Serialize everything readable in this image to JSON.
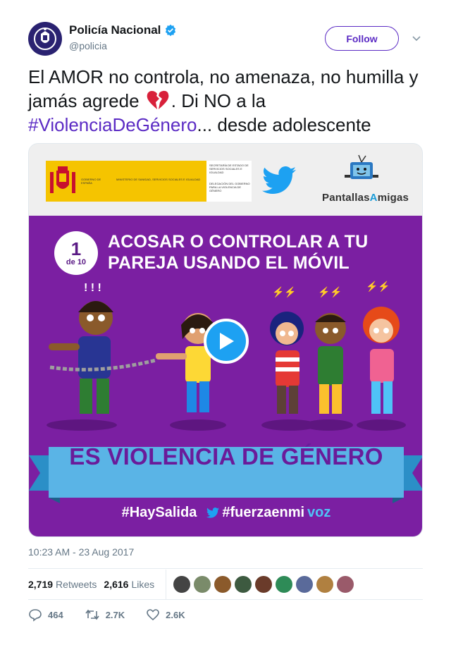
{
  "account": {
    "display_name": "Policía Nacional",
    "handle": "@policia",
    "verified": true,
    "follow_label": "Follow"
  },
  "tweet": {
    "text_part1": "El AMOR no controla, no amenaza, no humilla y jamás agrede ",
    "text_part2": ". Di NO a la ",
    "hashtag": "#ViolenciaDeGénero",
    "text_part3": "... desde adolescente",
    "emoji": "broken-heart-icon"
  },
  "media": {
    "gov_logo": {
      "left_text": "GOBIERNO DE ESPAÑA",
      "mid_text": "MINISTERIO DE SANIDAD, SERVICIOS SOCIALES E IGUALDAD",
      "right_text_1": "SECRETARÍA DE ESTADO DE SERVICIOS SOCIALES E IGUALDAD",
      "right_text_2": "DELEGACIÓN DEL GOBIERNO PARA LA VIOLENCIA DE GÉNERO"
    },
    "brand": {
      "part1": "Pantallas",
      "part2": "A",
      "part3": "migas"
    },
    "badge_number": "1",
    "badge_sub": "de 10",
    "headline": "ACOSAR O CONTROLAR A TU PAREJA USANDO EL MÓVIL",
    "ribbon": "ES VIOLENCIA DE GÉNERO",
    "hashtag1": "#HaySalida",
    "hashtag2_part1": "#fuerzaenmi",
    "hashtag2_part2": "voz",
    "colors": {
      "purple": "#7b1fa2",
      "ribbon": "#5ab4e6",
      "twitter_blue": "#1da1f2"
    }
  },
  "timestamp": "10:23 AM - 23 Aug 2017",
  "stats": {
    "retweets_count": "2,719",
    "retweets_label": "Retweets",
    "likes_count": "2,616",
    "likes_label": "Likes"
  },
  "actions": {
    "reply_count": "464",
    "retweet_count": "2.7K",
    "like_count": "2.6K"
  },
  "colors": {
    "link": "#5b2bc4",
    "muted": "#657786",
    "text": "#14171a"
  }
}
